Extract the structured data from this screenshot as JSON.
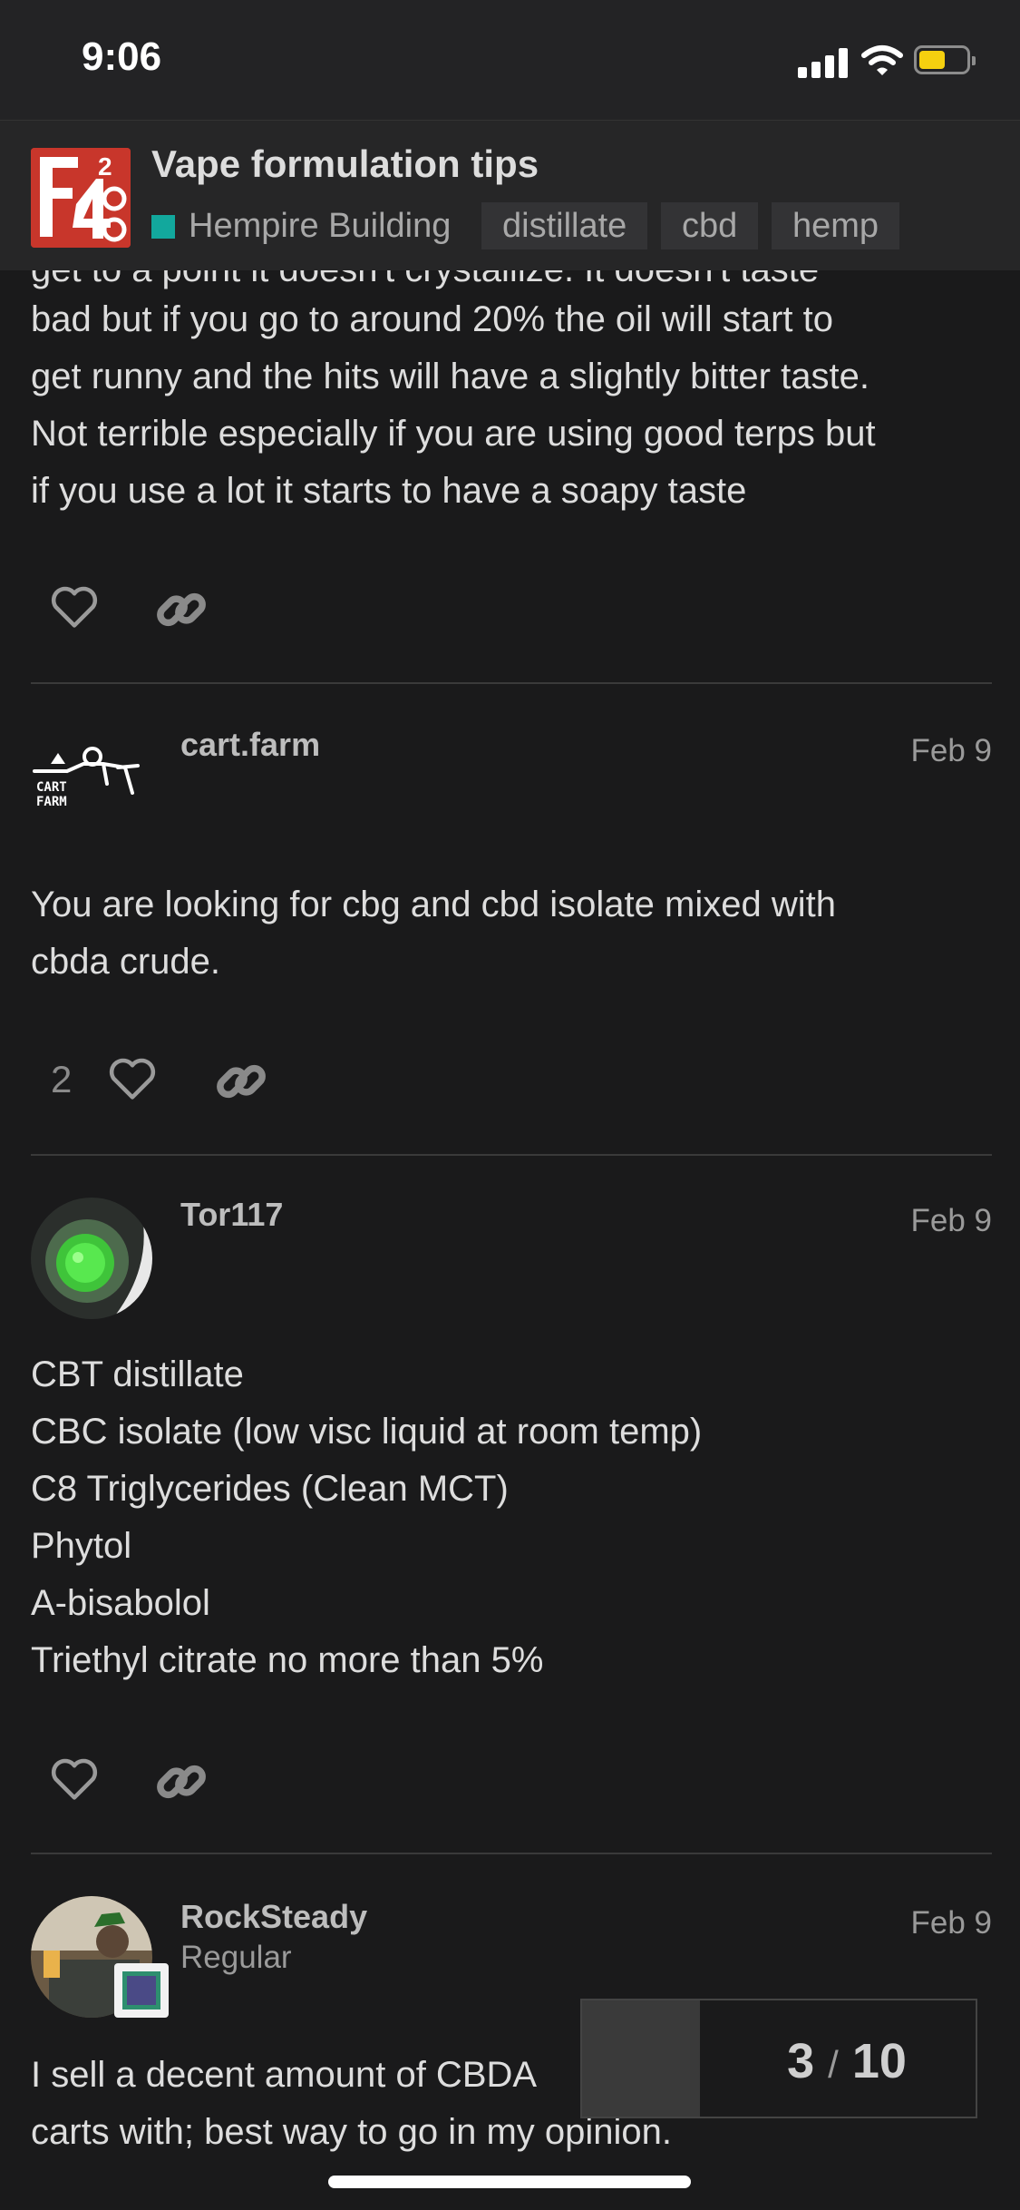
{
  "status_bar": {
    "time": "9:06"
  },
  "topic": {
    "title": "Vape formulation tips",
    "category": "Hempire Building",
    "category_color": "#12a89d",
    "tags": [
      "distillate",
      "cbd",
      "hemp"
    ]
  },
  "previous_post": {
    "clipped_line": "get to a point it doesn't crystallize. It doesn't taste",
    "lines": [
      "bad but if you go to around 20% the oil will start to",
      "get runny and the hits will have a slightly bitter taste.",
      "Not terrible especially if you are using good terps but",
      "if you use a lot it starts to have a soapy taste"
    ]
  },
  "posts": [
    {
      "username": "cart.farm",
      "date": "Feb 9",
      "avatar_text": [
        "CART",
        "FARM"
      ],
      "lines": [
        "You are looking for cbg and cbd isolate mixed with",
        "cbda crude."
      ],
      "likes": "2"
    },
    {
      "username": "Tor117",
      "date": "Feb 9",
      "lines": [
        "CBT distillate",
        "CBC isolate (low visc liquid at room temp)",
        "C8 Triglycerides (Clean MCT)",
        "Phytol",
        "A-bisabolol",
        "Triethyl citrate no more than 5%"
      ]
    },
    {
      "username": "RockSteady",
      "user_title": "Regular",
      "date": "Feb 9",
      "lines": [
        "I sell a decent amount of CBDA",
        "carts with; best way to go in my opinion."
      ]
    }
  ],
  "progress": {
    "current": "3",
    "separator": "/",
    "total": "10",
    "fraction": 0.3
  },
  "icons": [
    "heart-icon",
    "link-icon",
    "signal-icon",
    "wifi-icon",
    "battery-icon"
  ],
  "colors": {
    "background": "#1a1a1b",
    "header": "#262627",
    "battery": "#f5d00f",
    "logo": "#c8362b"
  }
}
